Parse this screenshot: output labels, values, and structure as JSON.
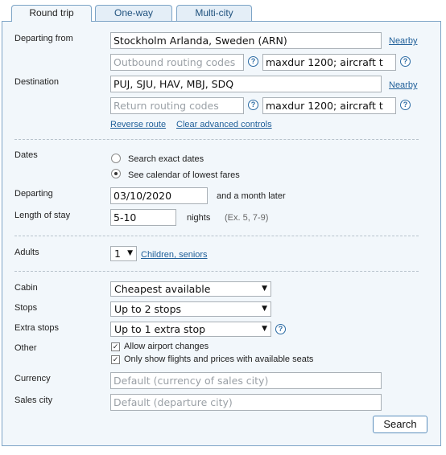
{
  "tabs": [
    "Round trip",
    "One-way",
    "Multi-city"
  ],
  "departing_from": {
    "label": "Departing from",
    "value": "Stockholm Arlanda, Sweden (ARN)",
    "nearby": "Nearby",
    "routing_placeholder": "Outbound routing codes",
    "extension": "maxdur 1200; aircraft t"
  },
  "destination": {
    "label": "Destination",
    "value": "PUJ, SJU, HAV, MBJ, SDQ",
    "nearby": "Nearby",
    "routing_placeholder": "Return routing codes",
    "extension": "maxdur 1200; aircraft t"
  },
  "links": {
    "reverse": "Reverse route",
    "clear": "Clear advanced controls"
  },
  "dates": {
    "label": "Dates",
    "option_exact": "Search exact dates",
    "option_calendar": "See calendar of lowest fares",
    "selected": "calendar",
    "departing_label": "Departing",
    "departing_value": "03/10/2020",
    "departing_suffix": "and a month later",
    "stay_label": "Length of stay",
    "stay_value": "5-10",
    "stay_unit": "nights",
    "stay_example": "(Ex. 5, 7-9)"
  },
  "passengers": {
    "label": "Adults",
    "adults": "1",
    "children_link": "Children, seniors"
  },
  "cabin": {
    "label": "Cabin",
    "value": "Cheapest available"
  },
  "stops": {
    "label": "Stops",
    "value": "Up to 2 stops"
  },
  "extra_stops": {
    "label": "Extra stops",
    "value": "Up to 1 extra stop"
  },
  "other": {
    "label": "Other",
    "airport_changes": "Allow airport changes",
    "available_seats": "Only show flights and prices with available seats"
  },
  "currency": {
    "label": "Currency",
    "placeholder": "Default (currency of sales city)"
  },
  "sales_city": {
    "label": "Sales city",
    "placeholder": "Default (departure city)"
  },
  "search_button": "Search",
  "help_glyph": "?",
  "check_glyph": "✓",
  "arrow_glyph": "▼"
}
